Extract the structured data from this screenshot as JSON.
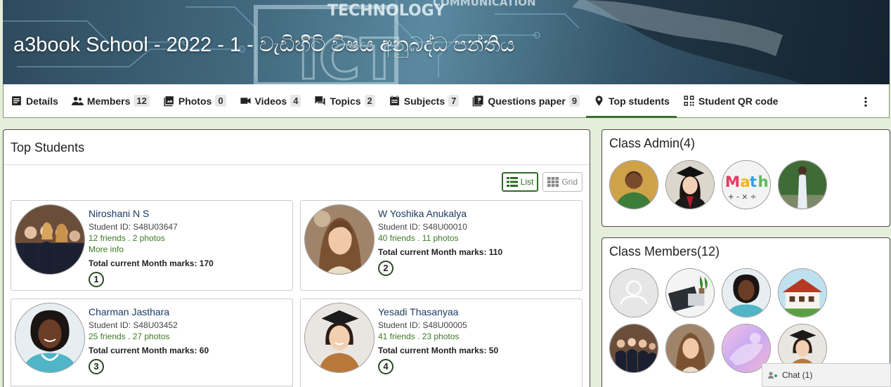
{
  "banner": {
    "title": "a3book School - 2022 - 1 - වැඩිහිටි විෂය අනුබද්ධ පන්තිය",
    "art_texts": [
      "TECHNOLOGY",
      "COMMUNICATION",
      "ICT"
    ]
  },
  "tabs": [
    {
      "label": "Details",
      "icon": "details-icon",
      "count": null
    },
    {
      "label": "Members",
      "icon": "members-icon",
      "count": "12"
    },
    {
      "label": "Photos",
      "icon": "photos-icon",
      "count": "0"
    },
    {
      "label": "Videos",
      "icon": "videos-icon",
      "count": "4"
    },
    {
      "label": "Topics",
      "icon": "topics-icon",
      "count": "2"
    },
    {
      "label": "Subjects",
      "icon": "subjects-icon",
      "count": "7"
    },
    {
      "label": "Questions paper",
      "icon": "questions-icon",
      "count": "9"
    },
    {
      "label": "Top students",
      "icon": "location-pin-icon",
      "count": null,
      "active": true
    },
    {
      "label": "Student QR code",
      "icon": "qr-code-icon",
      "count": null
    }
  ],
  "main": {
    "title": "Top Students",
    "view_list": "List",
    "view_grid": "Grid",
    "students": [
      {
        "name": "Niroshani N S",
        "id": "Student ID: S48U03647",
        "stats": "12 friends . 2 photos",
        "more": "More info",
        "marks": "Total current Month marks: 170",
        "rank": "1"
      },
      {
        "name": "W Yoshika Anukalya",
        "id": "Student ID: S48U00010",
        "stats": "40 friends . 11 photos",
        "more": "",
        "marks": "Total current Month marks: 110",
        "rank": "2"
      },
      {
        "name": "Charman Jasthara",
        "id": "Student ID: S48U03452",
        "stats": "25 friends . 27 photos",
        "more": "",
        "marks": "Total current Month marks: 60",
        "rank": "3"
      },
      {
        "name": "Yesadi Thasanyaa",
        "id": "Student ID: S48U00005",
        "stats": "41 friends . 23 photos",
        "more": "",
        "marks": "Total current Month marks: 50",
        "rank": "4"
      }
    ]
  },
  "class_admin": {
    "title": "Class Admin(4)"
  },
  "class_members": {
    "title": "Class Members(12)"
  },
  "chat": {
    "label": "Chat (1)"
  },
  "colors": {
    "accent": "#3c6e2e",
    "page_bg": "#e4eedb",
    "name_link": "#1c3a64",
    "stat_text": "#3b7a26"
  }
}
